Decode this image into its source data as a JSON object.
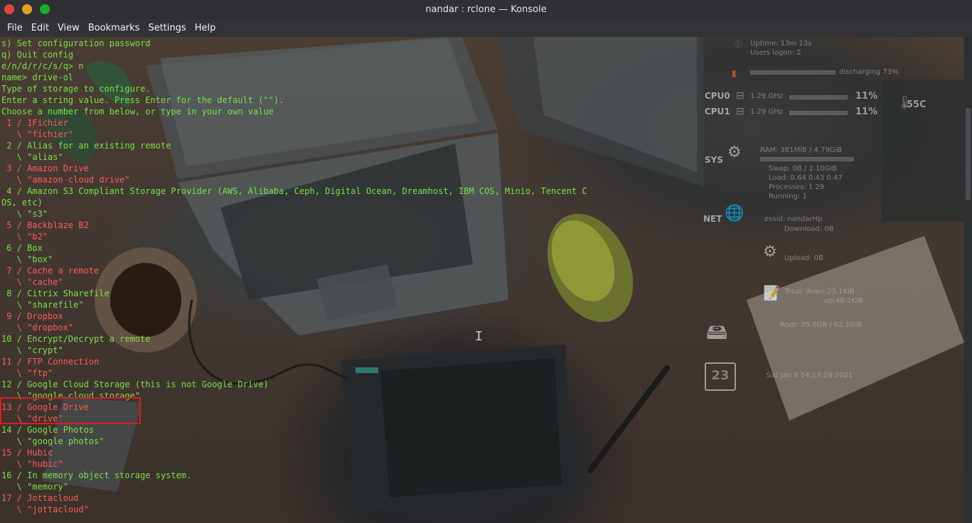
{
  "window": {
    "title": "nandar : rclone — Konsole"
  },
  "menu": [
    "File",
    "Edit",
    "View",
    "Bookmarks",
    "Settings",
    "Help"
  ],
  "terminal": {
    "lines": [
      {
        "text": "s) Set configuration password",
        "color": "green"
      },
      {
        "text": "q) Quit config",
        "color": "green"
      },
      {
        "text": "e/n/d/r/c/s/q> n",
        "color": "green"
      },
      {
        "text": "name> drive-ol",
        "color": "green"
      },
      {
        "text": "Type of storage to configure.",
        "color": "green"
      },
      {
        "text": "Enter a string value. Press Enter for the default (\"\").",
        "color": "green"
      },
      {
        "text": "Choose a number from below, or type in your own value",
        "color": "green"
      },
      {
        "text": " 1 / 1Fichier",
        "color": "red"
      },
      {
        "text": "   \\ \"fichier\"",
        "color": "red"
      },
      {
        "text": " 2 / Alias for an existing remote",
        "color": "green"
      },
      {
        "text": "   \\ \"alias\"",
        "color": "green"
      },
      {
        "text": " 3 / Amazon Drive",
        "color": "red"
      },
      {
        "text": "   \\ \"amazon cloud drive\"",
        "color": "red"
      },
      {
        "text": " 4 / Amazon S3 Compliant Storage Provider (AWS, Alibaba, Ceph, Digital Ocean, Dreamhost, IBM COS, Minio, Tencent C",
        "color": "green"
      },
      {
        "text": "OS, etc)",
        "color": "green"
      },
      {
        "text": "   \\ \"s3\"",
        "color": "green"
      },
      {
        "text": " 5 / Backblaze B2",
        "color": "red"
      },
      {
        "text": "   \\ \"b2\"",
        "color": "red"
      },
      {
        "text": " 6 / Box",
        "color": "green"
      },
      {
        "text": "   \\ \"box\"",
        "color": "green"
      },
      {
        "text": " 7 / Cache a remote",
        "color": "red"
      },
      {
        "text": "   \\ \"cache\"",
        "color": "red"
      },
      {
        "text": " 8 / Citrix Sharefile",
        "color": "green"
      },
      {
        "text": "   \\ \"sharefile\"",
        "color": "green"
      },
      {
        "text": " 9 / Dropbox",
        "color": "red"
      },
      {
        "text": "   \\ \"dropbox\"",
        "color": "red"
      },
      {
        "text": "10 / Encrypt/Decrypt a remote",
        "color": "green"
      },
      {
        "text": "   \\ \"crypt\"",
        "color": "green"
      },
      {
        "text": "11 / FTP Connection",
        "color": "red"
      },
      {
        "text": "   \\ \"ftp\"",
        "color": "red"
      },
      {
        "text": "12 / Google Cloud Storage (this is not Google Drive)",
        "color": "green"
      },
      {
        "text": "   \\ \"google cloud storage\"",
        "color": "green"
      },
      {
        "text": "13 / Google Drive",
        "color": "red"
      },
      {
        "text": "   \\ \"drive\"",
        "color": "red"
      },
      {
        "text": "14 / Google Photos",
        "color": "green"
      },
      {
        "text": "   \\ \"google photos\"",
        "color": "green"
      },
      {
        "text": "15 / Hubic",
        "color": "red"
      },
      {
        "text": "   \\ \"hubic\"",
        "color": "red"
      },
      {
        "text": "16 / In memory object storage system.",
        "color": "green"
      },
      {
        "text": "   \\ \"memory\"",
        "color": "green"
      },
      {
        "text": "17 / Jottacloud",
        "color": "red"
      },
      {
        "text": "   \\ \"jottacloud\"",
        "color": "red"
      }
    ]
  },
  "conky": {
    "uptime": "Uptime: 13m 13s",
    "users": "Users logon: 2",
    "battery": "discharging 73%",
    "cpu0_label": "CPU0",
    "cpu0_freq": "1.29 GHz",
    "cpu0_pct": "11%",
    "cpu1_label": "CPU1",
    "cpu1_freq": "1.29 GHz",
    "cpu1_pct": "11%",
    "temp": "55C",
    "sys_label": "SYS",
    "ram": "RAM: 381MiB / 4.79GiB",
    "swap": "Swap: 0B / 1.10GiB",
    "load": "Load: 0.64 0.43 0.47",
    "processes": "Processes: 1 29",
    "running": "Running: 1",
    "net_label": "NET",
    "essid": "essid: nandarHp",
    "download": "Download: 0B",
    "upload": "Upload: 0B",
    "total": "Total:  down:23.1KiB",
    "total_up": "up:40.1KiB",
    "root": "Root: 35.0GB / 62.1GiB",
    "calendar_day": "23",
    "datetime": "Sat Jan 9 14:13:29 2021"
  },
  "colors": {
    "green": "#78e048",
    "red": "#ff5a5a",
    "highlight": "#e01b1b"
  }
}
